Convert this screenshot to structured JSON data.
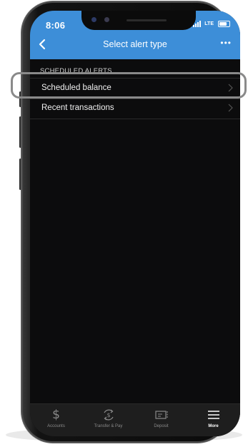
{
  "status_bar": {
    "time": "8:06",
    "network": "LTE"
  },
  "header": {
    "title": "Select alert type"
  },
  "section": {
    "title": "SCHEDULED ALERTS"
  },
  "items": [
    {
      "label": "Scheduled balance"
    },
    {
      "label": "Recent transactions"
    }
  ],
  "tabs": [
    {
      "label": "Accounts",
      "icon": "dollar-icon"
    },
    {
      "label": "Transfer & Pay",
      "icon": "transfer-pay-icon"
    },
    {
      "label": "Deposit",
      "icon": "deposit-check-icon"
    },
    {
      "label": "More",
      "icon": "menu-icon",
      "active": true
    }
  ],
  "colors": {
    "header_bg": "#3d8ed8",
    "screen_bg": "#0c0c0d",
    "tabbar_bg": "#1e1e1e",
    "highlight": "#8a8a8a"
  }
}
